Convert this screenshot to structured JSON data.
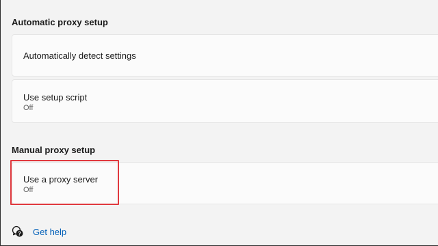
{
  "sections": {
    "automatic": {
      "title": "Automatic proxy setup",
      "items": [
        {
          "label": "Automatically detect settings"
        },
        {
          "label": "Use setup script",
          "status": "Off"
        }
      ]
    },
    "manual": {
      "title": "Manual proxy setup",
      "items": [
        {
          "label": "Use a proxy server",
          "status": "Off"
        }
      ]
    }
  },
  "footer": {
    "help_label": "Get help",
    "help_icon": "help-chat-icon"
  },
  "colors": {
    "highlight": "#e0393e",
    "link": "#005fb8",
    "card_bg": "#fbfbfb",
    "page_bg": "#f3f3f3"
  }
}
